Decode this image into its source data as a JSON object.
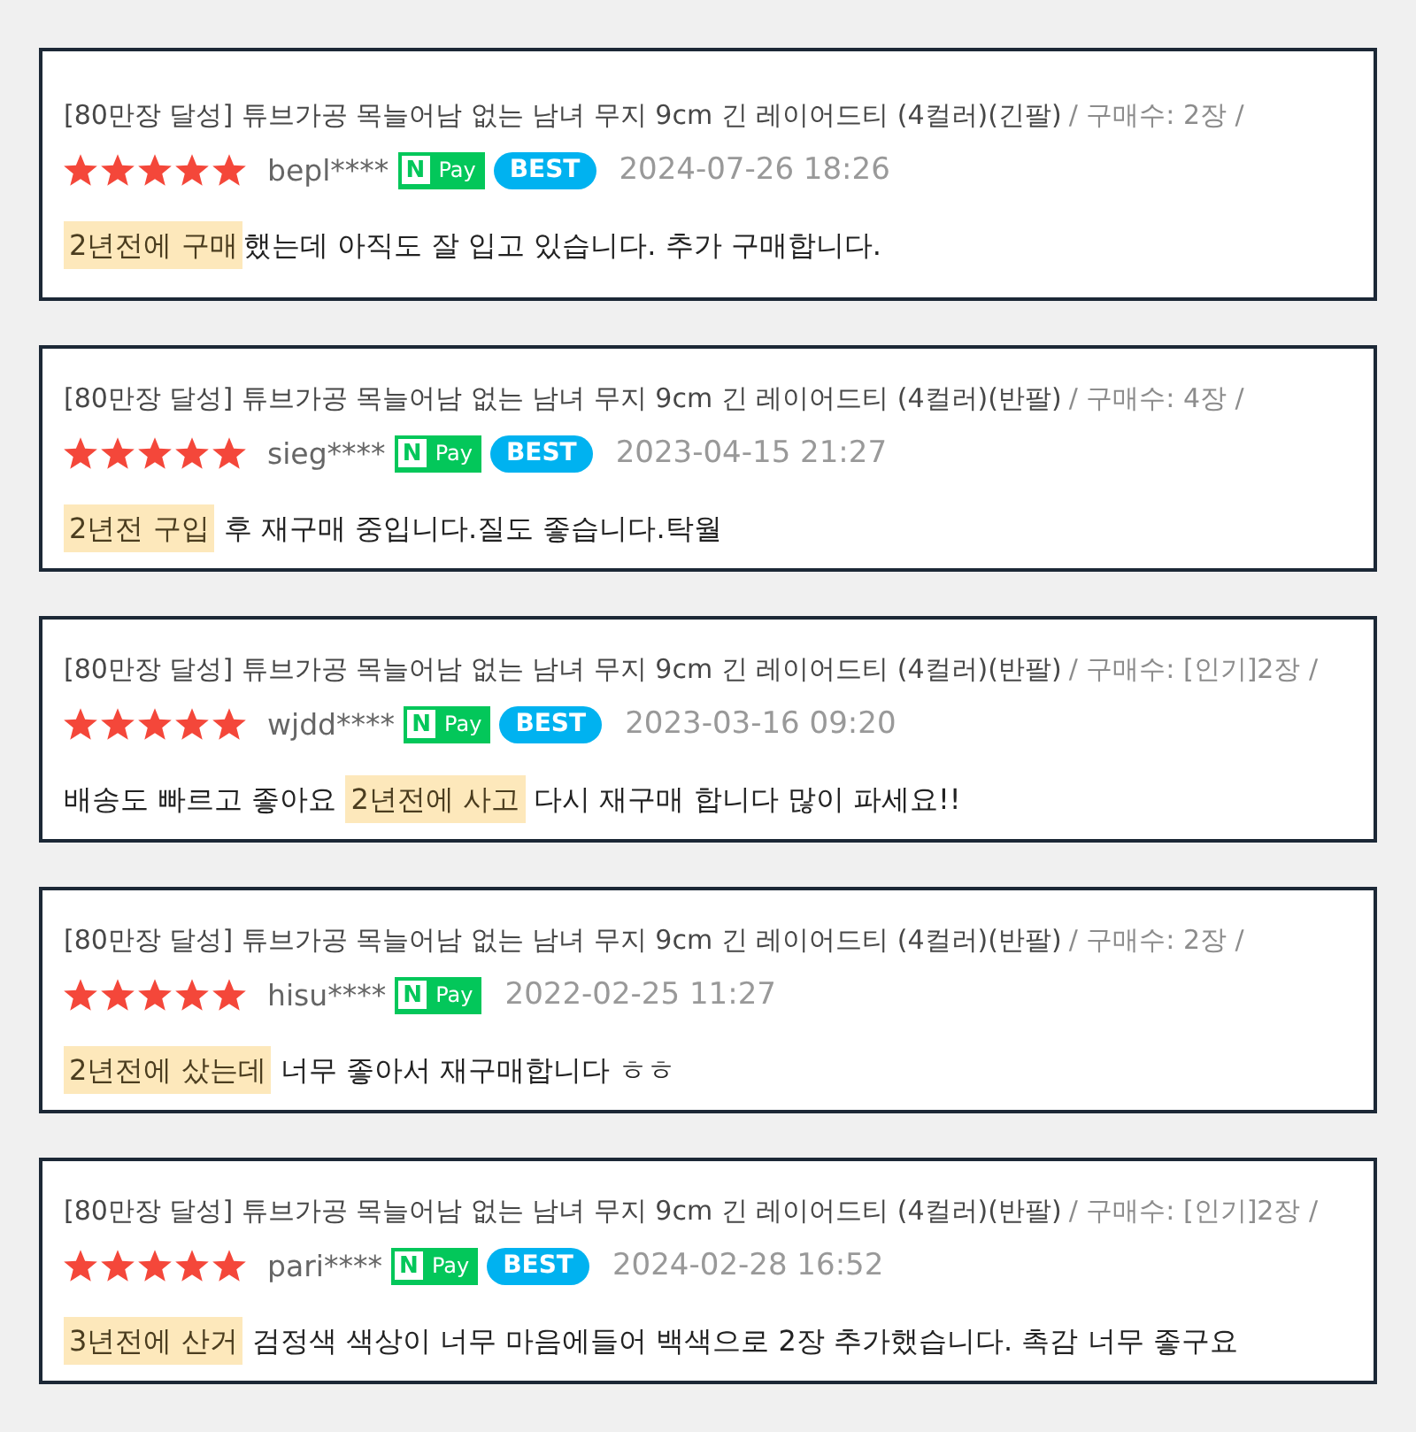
{
  "reviews": [
    {
      "product": "[80만장 달성] 튜브가공 목늘어남 없는 남녀 무지 9cm 긴 레이어드티 (4컬러)(긴팔)",
      "purchase": "/ 구매수: 2장 /",
      "stars": 5,
      "user": "bepl****",
      "badges": [
        {
          "kind": "npay",
          "mark": "N",
          "label": "Pay"
        },
        {
          "kind": "best",
          "label": "BEST"
        }
      ],
      "date": "2024-07-26 18:26",
      "body": [
        {
          "text": "2년전에 구매",
          "highlighted": true
        },
        {
          "text": "했는데 아직도 잘 입고 있습니다. 추가 구매합니다.",
          "highlighted": false
        }
      ]
    },
    {
      "product": "[80만장 달성] 튜브가공 목늘어남 없는 남녀 무지 9cm 긴 레이어드티 (4컬러)(반팔)",
      "purchase": "/ 구매수: 4장 /",
      "stars": 5,
      "user": "sieg****",
      "badges": [
        {
          "kind": "npay",
          "mark": "N",
          "label": "Pay"
        },
        {
          "kind": "best",
          "label": "BEST"
        }
      ],
      "date": "2023-04-15 21:27",
      "body": [
        {
          "text": "2년전 구입",
          "highlighted": true
        },
        {
          "text": " 후 재구매 중입니다.질도 좋습니다.탁월",
          "highlighted": false
        }
      ]
    },
    {
      "product": "[80만장 달성] 튜브가공 목늘어남 없는 남녀 무지 9cm 긴 레이어드티 (4컬러)(반팔)",
      "purchase": "/ 구매수: [인기]2장 /",
      "stars": 5,
      "user": "wjdd****",
      "badges": [
        {
          "kind": "npay",
          "mark": "N",
          "label": "Pay"
        },
        {
          "kind": "best",
          "label": "BEST"
        }
      ],
      "date": "2023-03-16 09:20",
      "body": [
        {
          "text": "배송도 빠르고 좋아요 ",
          "highlighted": false
        },
        {
          "text": "2년전에 사고",
          "highlighted": true
        },
        {
          "text": " 다시 재구매 합니다 많이 파세요!!",
          "highlighted": false
        }
      ]
    },
    {
      "product": "[80만장 달성] 튜브가공 목늘어남 없는 남녀 무지 9cm 긴 레이어드티 (4컬러)(반팔)",
      "purchase": "/ 구매수: 2장 /",
      "stars": 5,
      "user": "hisu****",
      "badges": [
        {
          "kind": "npay",
          "mark": "N",
          "label": "Pay"
        }
      ],
      "date": "2022-02-25 11:27",
      "body": [
        {
          "text": "2년전에 샀는데",
          "highlighted": true
        },
        {
          "text": " 너무 좋아서 재구매합니다 ㅎㅎ",
          "highlighted": false
        }
      ]
    },
    {
      "product": "[80만장 달성] 튜브가공 목늘어남 없는 남녀 무지 9cm 긴 레이어드티 (4컬러)(반팔)",
      "purchase": "/ 구매수: [인기]2장 /",
      "stars": 5,
      "user": "pari****",
      "badges": [
        {
          "kind": "npay",
          "mark": "N",
          "label": "Pay"
        },
        {
          "kind": "best",
          "label": "BEST"
        }
      ],
      "date": "2024-02-28 16:52",
      "body": [
        {
          "text": "3년전에 산거",
          "highlighted": true
        },
        {
          "text": " 검정색 색상이 너무 마음에들어 백색으로 2장 추가했습니다. 촉감 너무 좋구요",
          "highlighted": false
        }
      ]
    }
  ]
}
